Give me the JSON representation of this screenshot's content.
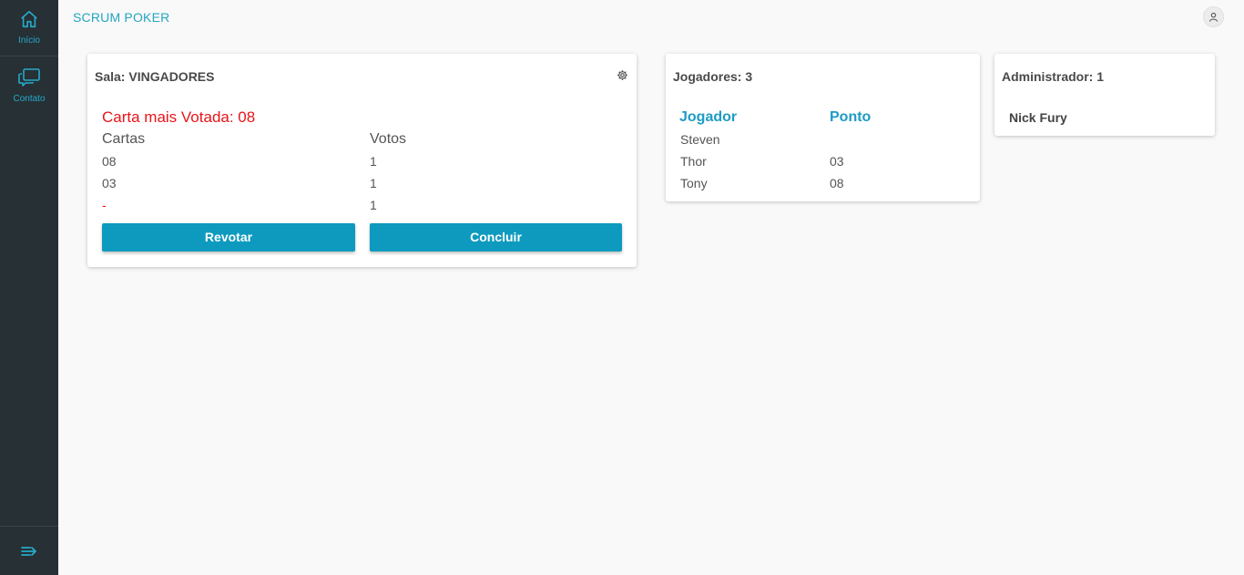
{
  "sidebar": {
    "items": [
      {
        "label": "Início",
        "icon": "home-icon"
      },
      {
        "label": "Contato",
        "icon": "chat-icon"
      }
    ],
    "collapse_icon": "collapse-arrow-icon"
  },
  "header": {
    "title": "SCRUM POKER",
    "avatar_icon": "user-icon"
  },
  "room": {
    "title": "Sala: VINGADORES",
    "settings_icon": "gear-icon",
    "most_voted": "Carta mais Votada: 08",
    "col_cards": "Cartas",
    "col_votes": "Votos",
    "rows": [
      {
        "card": "08",
        "votes": "1"
      },
      {
        "card": "03",
        "votes": "1"
      },
      {
        "card": "-",
        "votes": "1"
      }
    ],
    "revote_label": "Revotar",
    "finish_label": "Concluir"
  },
  "players": {
    "title": "Jogadores: 3",
    "col_player": "Jogador",
    "col_points": "Ponto",
    "rows": [
      {
        "name": "Steven",
        "points": ""
      },
      {
        "name": "Thor",
        "points": "03"
      },
      {
        "name": "Tony",
        "points": "08"
      }
    ]
  },
  "admin": {
    "title": "Administrador: 1",
    "name": "Nick Fury"
  },
  "colors": {
    "accent": "#0e9abf",
    "sidebar_bg": "#263035",
    "highlight_red": "#e8141a"
  }
}
